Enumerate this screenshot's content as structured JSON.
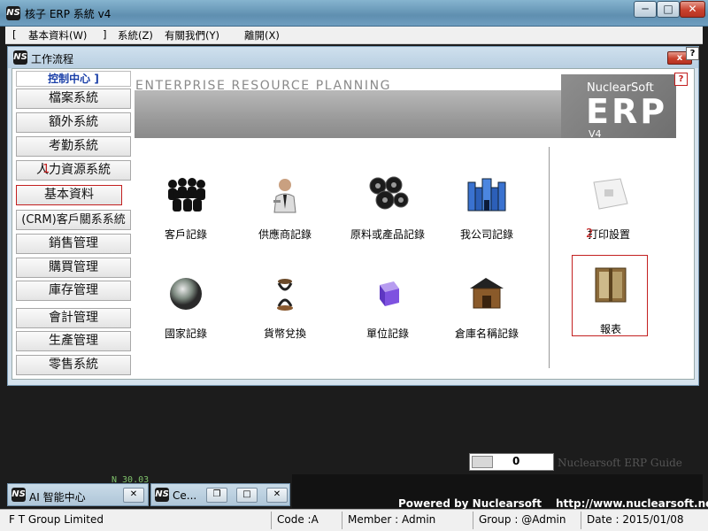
{
  "window": {
    "title": "核子 ERP 系統 v4",
    "logo": "NS",
    "buttons": [
      "─",
      "□",
      "✕"
    ]
  },
  "menubar": {
    "left_bracket": "[",
    "items": [
      "基本資料(W)",
      "]",
      "系統(Z)",
      "有關我們(Y)",
      "離開(X)"
    ]
  },
  "child": {
    "title": "工作流程",
    "close": "x",
    "help": "?"
  },
  "sidebar": {
    "header": "控制中心 ]",
    "items": [
      "檔案系統",
      "額外系統",
      "考勤系統",
      "人力資源系統",
      "基本資料",
      "(CRM)客戶關系系統",
      "銷售管理",
      "購買管理",
      "庫存管理",
      "會計管理",
      "生產管理",
      "零售系統"
    ],
    "active_index": 4
  },
  "banner": {
    "slogan": "ENTERPRISE RESOURCE PLANNING",
    "brand_small": "NuclearSoft",
    "brand_big": "ERP",
    "brand_version": "V4",
    "help": "?"
  },
  "tiles": [
    {
      "label": "客戶記錄",
      "icon": "customers-icon"
    },
    {
      "label": "供應商記錄",
      "icon": "supplier-icon"
    },
    {
      "label": "原料或產品記錄",
      "icon": "materials-icon"
    },
    {
      "label": "我公司記錄",
      "icon": "company-icon"
    },
    {
      "label": "打印設置",
      "icon": "printer-settings-icon"
    },
    {
      "label": "國家記錄",
      "icon": "country-icon"
    },
    {
      "label": "貨幣兌換",
      "icon": "currency-icon"
    },
    {
      "label": "單位記錄",
      "icon": "unit-icon"
    },
    {
      "label": "倉庫名稱記錄",
      "icon": "warehouse-icon"
    },
    {
      "label": "報表",
      "icon": "report-icon"
    }
  ],
  "annotations": {
    "one": "1",
    "two": "2"
  },
  "guide": {
    "value": "0",
    "text": "Nuclearsoft ERP Guide"
  },
  "minimized": [
    {
      "title": "AI 智能中心"
    },
    {
      "title": "Ce..."
    }
  ],
  "footer": {
    "powered": "Powered by Nuclearsoft",
    "site": "http://www.nuclearsoft.net",
    "mini_num": "N 30.03"
  },
  "statusbar": {
    "company": "F T Group Limited",
    "code": "Code :A",
    "member": "Member :  Admin",
    "group": "Group :  @Admin",
    "date": "Date :  2015/01/08"
  },
  "colors": {
    "accent_red": "#c32020",
    "title_blue": "#6f9ec0",
    "header_blue": "#1a3fa8"
  }
}
